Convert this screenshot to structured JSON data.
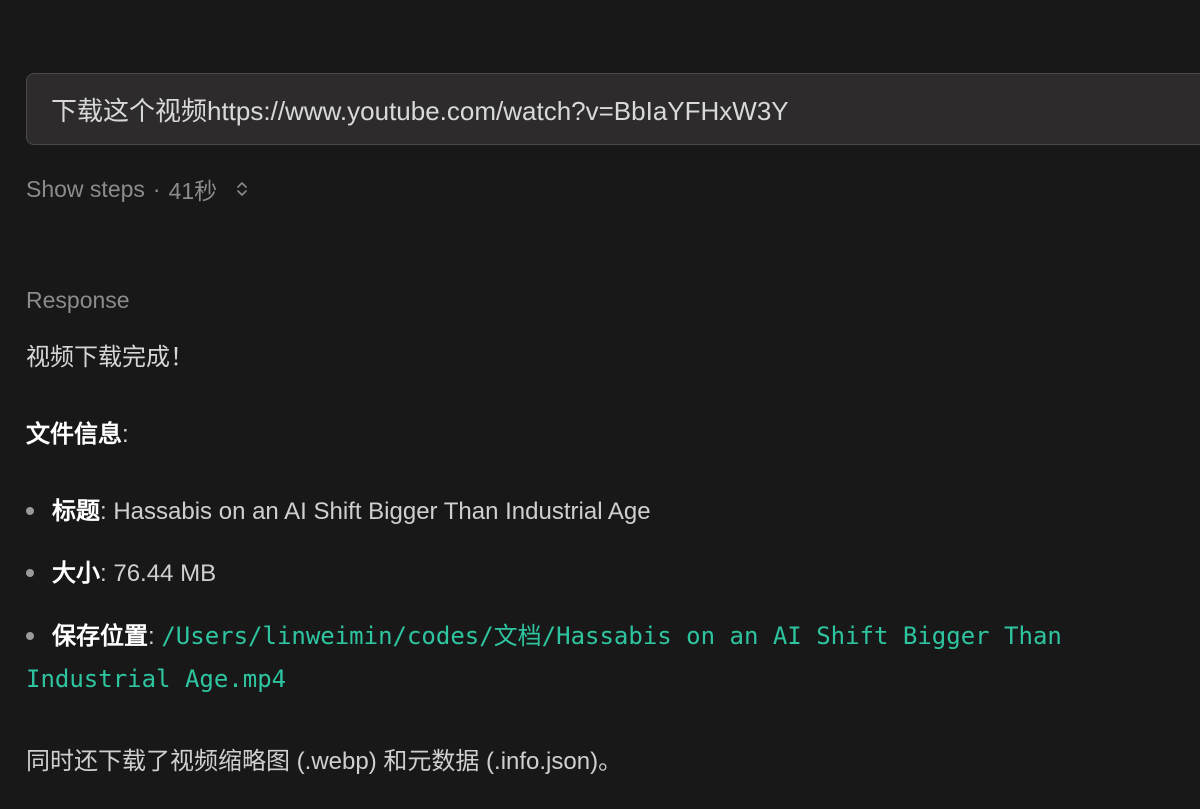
{
  "prompt": {
    "text": "下载这个视频https://www.youtube.com/watch?v=BbIaYFHxW3Y"
  },
  "steps": {
    "label": "Show steps",
    "separator": "·",
    "duration": "41秒",
    "icon": "chevron-up-down-icon"
  },
  "response": {
    "label": "Response",
    "done_text": "视频下载完成！",
    "file_info_heading": "文件信息",
    "file_info_colon": ":",
    "items": [
      {
        "key": "标题",
        "sep": ": ",
        "value": "Hassabis on an AI Shift Bigger Than Industrial Age"
      },
      {
        "key": "大小",
        "sep": ": ",
        "value": "76.44 MB"
      },
      {
        "key": "保存位置",
        "sep": ": ",
        "value_line1": "/Users/linweimin/codes/文档/Hassabis on an AI Shift Bigger Than",
        "value_line2": "Industrial Age.mp4"
      }
    ],
    "extra_text": "同时还下载了视频缩略图 (.webp) 和元数据 (.info.json)。"
  },
  "colors": {
    "background": "#181818",
    "prompt_bg": "#2d2b2b",
    "path_accent": "#2ec4a0",
    "muted": "#8b8b8b"
  }
}
